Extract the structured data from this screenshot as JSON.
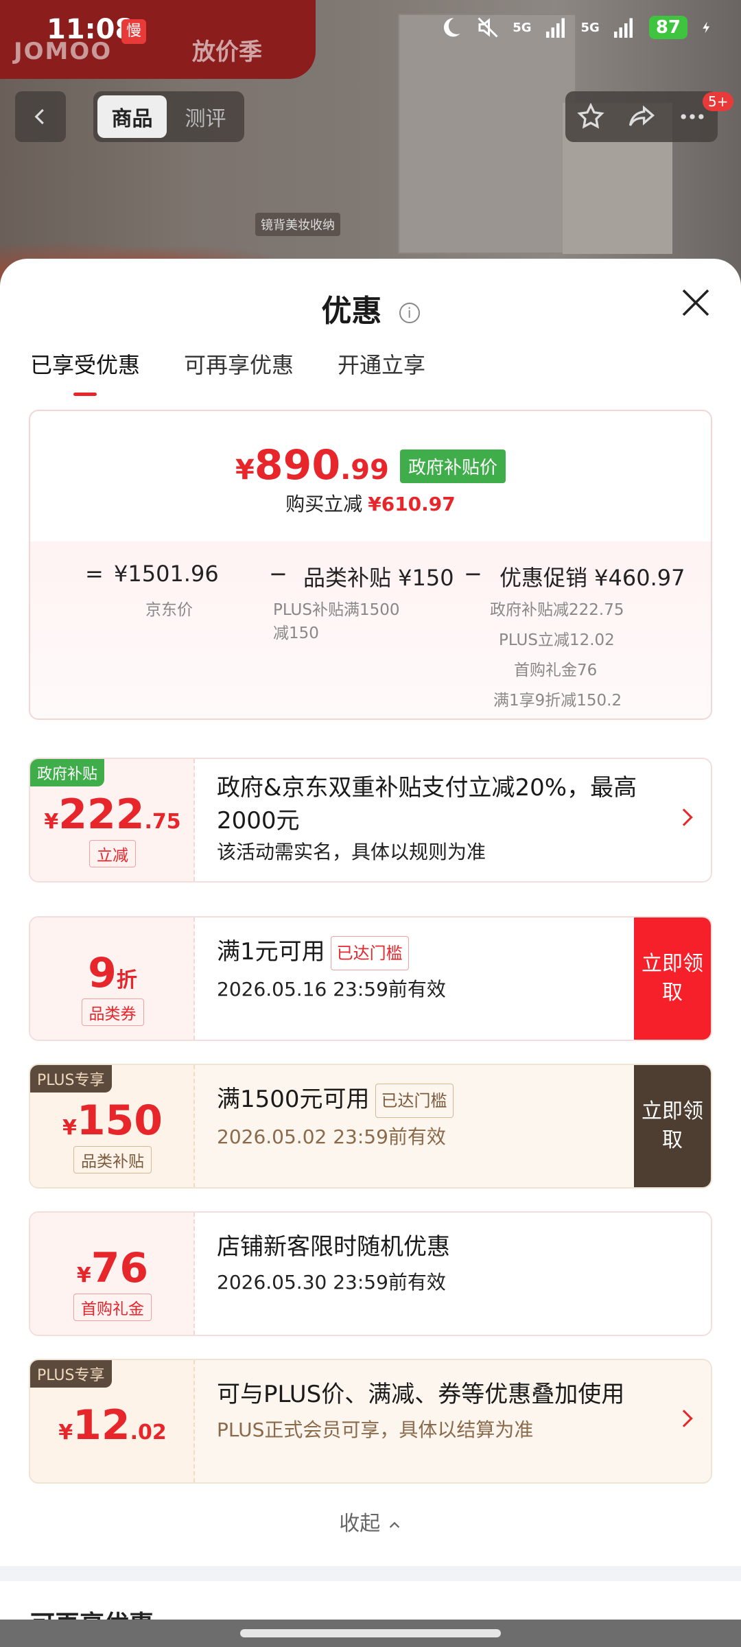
{
  "status_bar": {
    "time": "11:08",
    "slow_badge": "慢",
    "signal1": "5G",
    "signal2": "5G",
    "battery": "87"
  },
  "backdrop": {
    "logo": "JOMOO",
    "campaign": "放价季",
    "product_tag": "镜背美妆收纳"
  },
  "product_nav": {
    "tabs": [
      "商品",
      "测评"
    ],
    "message_badge": "5+"
  },
  "sheet": {
    "title": "优惠",
    "tabs": [
      "已享受优惠",
      "可再享优惠",
      "开通立享"
    ],
    "active_tab": 0
  },
  "summary": {
    "price_int": "890",
    "price_dec": ".99",
    "currency": "¥",
    "price_tag": "政府补贴价",
    "save_label": "购买立减",
    "save_amount": "¥610.97",
    "eq": "=",
    "jd_price": "¥1501.96",
    "jd_label": "京东价",
    "minus1": "−",
    "cat_subsidy": "品类补贴 ¥150",
    "cat_note1": "PLUS补贴满1500",
    "cat_note2": "减150",
    "minus2": "−",
    "promo": "优惠促销 ¥460.97",
    "promo_items": [
      "政府补贴减222.75",
      "PLUS立减12.02",
      "首购礼金76",
      "满1享9折减150.2"
    ]
  },
  "coupons": {
    "gov": {
      "ribbon": "政府补贴",
      "yen": "¥",
      "int": "222",
      "dec": ".75",
      "label": "立减",
      "title": "政府&京东双重补贴支付立减20%，最高2000元",
      "desc": "该活动需实名，具体以规则为准"
    },
    "discount": {
      "num": "9",
      "unit": "折",
      "label": "品类券",
      "title": "满1元可用",
      "reached": "已达门槛",
      "desc": "2026.05.16 23:59前有效",
      "claim": "立即领取"
    },
    "plus150": {
      "ribbon": "PLUS专享",
      "yen": "¥",
      "int": "150",
      "label": "品类补贴",
      "title": "满1500元可用",
      "reached": "已达门槛",
      "desc": "2026.05.02 23:59前有效",
      "claim": "立即领取"
    },
    "gift76": {
      "yen": "¥",
      "int": "76",
      "label": "首购礼金",
      "title": "店铺新客限时随机优惠",
      "desc": "2026.05.30 23:59前有效"
    },
    "plus12": {
      "ribbon": "PLUS专享",
      "yen": "¥",
      "int": "12",
      "dec": ".02",
      "title": "可与PLUS价、满减、券等优惠叠加使用",
      "desc": "PLUS正式会员可享，具体以结算为准"
    }
  },
  "collapse_label": "收起",
  "next_section": "可再享优惠",
  "colors": {
    "accent": "#e6262b",
    "gov_green": "#3fae4a",
    "plus_brown": "#4e3d31"
  }
}
